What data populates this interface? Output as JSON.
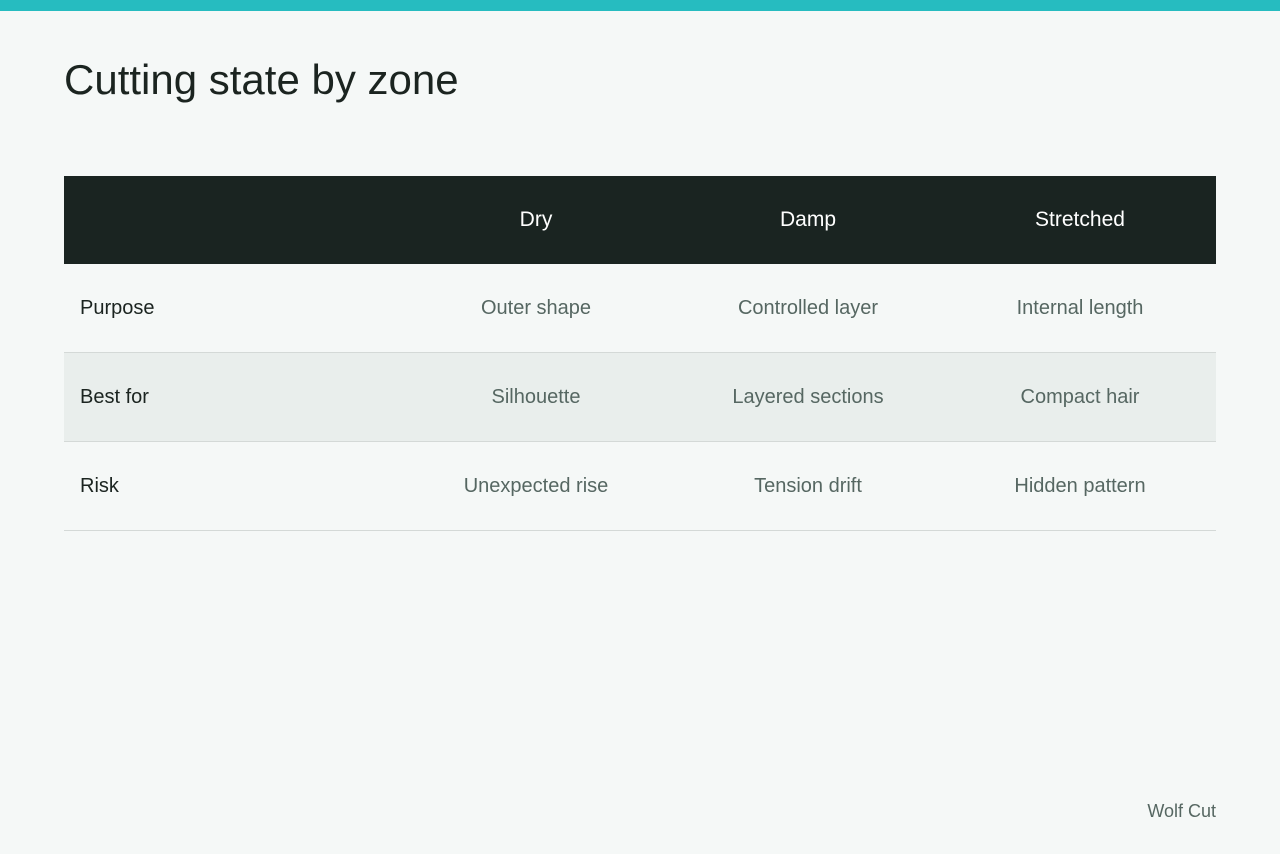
{
  "page": {
    "title": "Cutting state by zone",
    "brand": "Wolf Cut",
    "accent_color": "#26bcc0",
    "header_color": "#1a2421"
  },
  "table": {
    "corner": "",
    "columns": [
      "Dry",
      "Damp",
      "Stretched"
    ],
    "rows": [
      {
        "label": "Purpose",
        "cells": [
          "Outer shape",
          "Controlled layer",
          "Internal length"
        ]
      },
      {
        "label": "Best for",
        "cells": [
          "Silhouette",
          "Layered sections",
          "Compact hair"
        ]
      },
      {
        "label": "Risk",
        "cells": [
          "Unexpected rise",
          "Tension drift",
          "Hidden pattern"
        ]
      }
    ]
  }
}
